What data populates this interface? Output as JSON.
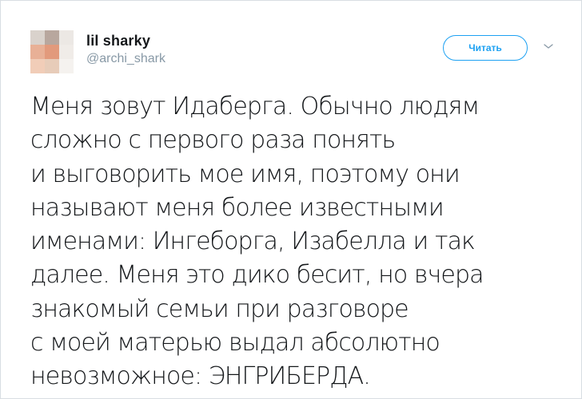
{
  "user": {
    "display_name": "lil sharky",
    "handle": "@archi_shark"
  },
  "follow_button": {
    "label": "Читать"
  },
  "menu": {
    "icon": "chevron-down-icon"
  },
  "avatar": {
    "icon": "pixelated-avatar",
    "colors": [
      "#d9d2cc",
      "#b8a79e",
      "#ece8e4",
      "#e8b096",
      "#e29a7c",
      "#f0ece8",
      "#f1cdb8",
      "#e7ccb9",
      "#f5f2ef"
    ]
  },
  "tweet": {
    "lines": [
      "Меня зовут Идаберга. Обычно людям",
      "сложно с первого раза понять",
      "и выговорить мое имя, поэтому они",
      "называют меня более известными",
      "именами: Ингеборга, Изабелла и так",
      "далее. Меня это дико бесит, но вчера",
      "знакомый семьи при разговоре",
      "с моей матерью выдал абсолютно",
      "невозможное: ЭНГРИБЕРДА."
    ]
  },
  "colors": {
    "accent": "#1da1f2",
    "secondary_text": "#8899a6",
    "primary_text": "#14171a",
    "border": "#d8dde2"
  }
}
